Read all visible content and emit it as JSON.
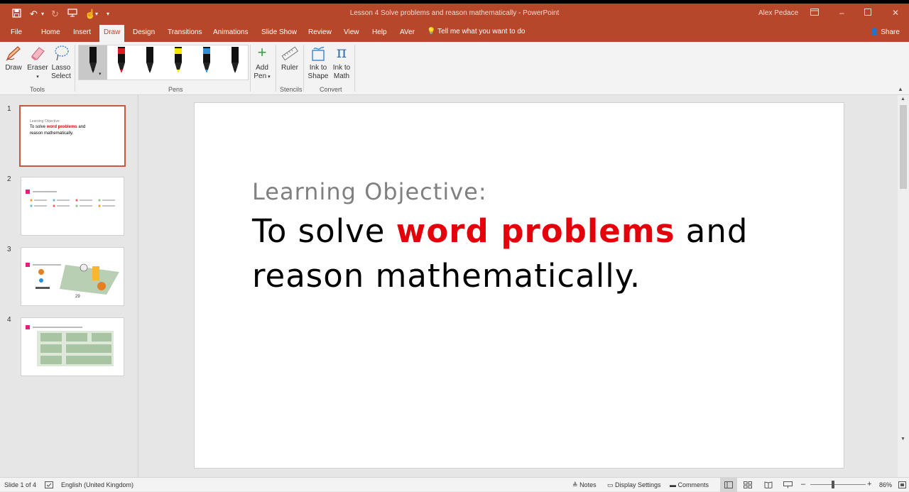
{
  "window": {
    "title": "Lesson 4 Solve problems and reason mathematically  -  PowerPoint",
    "user": "Alex Pedace"
  },
  "tabs": [
    "File",
    "Home",
    "Insert",
    "Draw",
    "Design",
    "Transitions",
    "Animations",
    "Slide Show",
    "Review",
    "View",
    "Help",
    "AVer"
  ],
  "active_tab": "Draw",
  "tell_me": "Tell me what you want to do",
  "share": "Share",
  "ribbon": {
    "tools": {
      "draw": "Draw",
      "eraser": "Eraser",
      "lasso": "Lasso",
      "lasso2": "Select",
      "group": "Tools"
    },
    "pens_group": "Pens",
    "add_pen": "Add",
    "add_pen2": "Pen",
    "ruler": "Ruler",
    "stencils_group": "Stencils",
    "ink_shape": "Ink to",
    "ink_shape2": "Shape",
    "ink_math": "Ink to",
    "ink_math2": "Math",
    "convert_group": "Convert",
    "pen_colors": [
      "#111111",
      "#d81e1e",
      "#111111",
      "#f5e800",
      "#2e8fd6",
      "#111111"
    ]
  },
  "slides": {
    "numbers": [
      "1",
      "2",
      "3",
      "4"
    ],
    "thumb1": {
      "line1": "Learning Objective:",
      "pre": "To solve ",
      "hl": "word problems",
      "post": " and",
      "line3": "reason mathematically."
    }
  },
  "slide": {
    "label": "Learning Objective:",
    "pre": "To solve ",
    "highlight": "word problems",
    "post": " and",
    "line2": "reason mathematically."
  },
  "status": {
    "slide": "Slide 1 of 4",
    "language": "English (United Kingdom)",
    "notes": "Notes",
    "display": "Display Settings",
    "comments": "Comments",
    "zoom": "86%"
  },
  "colors": {
    "accent": "#b7472a",
    "highlight": "#e3000b"
  }
}
